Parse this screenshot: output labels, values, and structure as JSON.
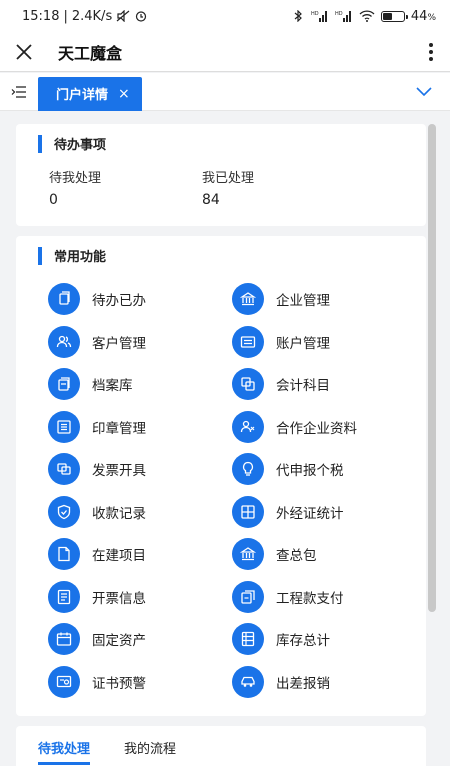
{
  "statusbar": {
    "time": "15:18",
    "speed": "2.4K/s",
    "battery": "44",
    "battery_unit": "%"
  },
  "appbar": {
    "title": "天工魔盒"
  },
  "tabs": {
    "active_label": "门户详情",
    "close_glyph": "×"
  },
  "todo": {
    "title": "待办事项",
    "stats": [
      {
        "label": "待我处理",
        "value": "0"
      },
      {
        "label": "我已处理",
        "value": "84"
      }
    ]
  },
  "functions": {
    "title": "常用功能",
    "items": [
      {
        "label": "待办已办",
        "icon": "document-copy-icon"
      },
      {
        "label": "企业管理",
        "icon": "bank-icon"
      },
      {
        "label": "客户管理",
        "icon": "users-icon"
      },
      {
        "label": "账户管理",
        "icon": "account-icon"
      },
      {
        "label": "档案库",
        "icon": "archive-icon"
      },
      {
        "label": "会计科目",
        "icon": "layers-icon"
      },
      {
        "label": "印章管理",
        "icon": "stamp-icon"
      },
      {
        "label": "合作企业资料",
        "icon": "partner-icon"
      },
      {
        "label": "发票开具",
        "icon": "invoice-icon"
      },
      {
        "label": "代申报个税",
        "icon": "lightbulb-icon"
      },
      {
        "label": "收款记录",
        "icon": "shield-check-icon"
      },
      {
        "label": "外经证统计",
        "icon": "grid-icon"
      },
      {
        "label": "在建项目",
        "icon": "file-icon"
      },
      {
        "label": "查总包",
        "icon": "bank-icon"
      },
      {
        "label": "开票信息",
        "icon": "receipt-icon"
      },
      {
        "label": "工程款支付",
        "icon": "payment-icon"
      },
      {
        "label": "固定资产",
        "icon": "calendar-icon"
      },
      {
        "label": "库存总计",
        "icon": "list-icon"
      },
      {
        "label": "证书预警",
        "icon": "certificate-icon"
      },
      {
        "label": "出差报销",
        "icon": "car-icon"
      }
    ]
  },
  "bottom_tabs": [
    {
      "label": "待我处理",
      "active": true
    },
    {
      "label": "我的流程",
      "active": false
    }
  ],
  "colors": {
    "accent": "#1a73e8",
    "background": "#f2f3f5"
  }
}
